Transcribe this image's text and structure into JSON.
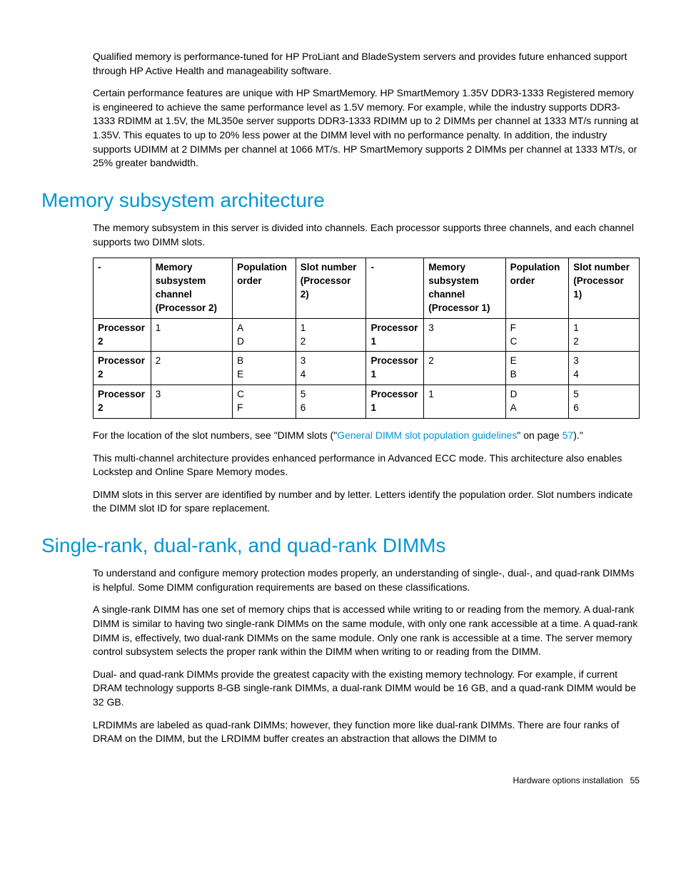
{
  "intro": {
    "p1": "Qualified memory is performance-tuned for HP ProLiant and BladeSystem servers and provides future enhanced support through HP Active Health and manageability software.",
    "p2": "Certain performance features are unique with HP SmartMemory. HP SmartMemory 1.35V DDR3-1333 Registered memory is engineered to achieve the same performance level as 1.5V memory. For example, while the industry supports DDR3-1333 RDIMM at 1.5V, the ML350e server supports DDR3-1333 RDIMM up to 2 DIMMs per channel at 1333 MT/s running at 1.35V. This equates to up to 20% less power at the DIMM level with no performance penalty. In addition, the industry supports UDIMM at 2 DIMMs per channel at 1066 MT/s. HP SmartMemory supports 2 DIMMs per channel at 1333 MT/s, or 25% greater bandwidth."
  },
  "section1": {
    "title": "Memory subsystem architecture",
    "p1": "The memory subsystem in this server is divided into channels. Each processor supports three channels, and each channel supports two DIMM slots.",
    "table": {
      "headers": [
        "-",
        "Memory subsystem channel (Processor 2)",
        "Population order",
        "Slot number (Processor 2)",
        "-",
        "Memory subsystem channel (Processor 1)",
        "Population order",
        "Slot number (Processor 1)"
      ],
      "rows": [
        [
          "Processor 2",
          "1",
          "A\nD",
          "1\n2",
          "Processor 1",
          "3",
          "F\nC",
          "1\n2"
        ],
        [
          "Processor 2",
          "2",
          "B\nE",
          "3\n4",
          "Processor 1",
          "2",
          "E\nB",
          "3\n4"
        ],
        [
          "Processor 2",
          "3",
          "C\nF",
          "5\n6",
          "Processor 1",
          "1",
          "D\nA",
          "5\n6"
        ]
      ]
    },
    "p2a": "For the location of the slot numbers, see \"DIMM slots (\"",
    "p2link": "General DIMM slot population guidelines",
    "p2b": "\" on page ",
    "p2pg": "57",
    "p2c": ").\"",
    "p3": "This multi-channel architecture provides enhanced performance in Advanced ECC mode. This architecture also enables Lockstep and Online Spare Memory modes.",
    "p4": "DIMM slots in this server are identified by number and by letter. Letters identify the population order. Slot numbers indicate the DIMM slot ID for spare replacement."
  },
  "section2": {
    "title": "Single-rank, dual-rank, and quad-rank DIMMs",
    "p1": "To understand and configure memory protection modes properly, an understanding of single-, dual-, and quad-rank DIMMs is helpful. Some DIMM configuration requirements are based on these classifications.",
    "p2": "A single-rank DIMM has one set of memory chips that is accessed while writing to or reading from the memory. A dual-rank DIMM is similar to having two single-rank DIMMs on the same module, with only one rank accessible at a time. A quad-rank DIMM is, effectively, two dual-rank DIMMs on the same module. Only one rank is accessible at a time. The server memory control subsystem selects the proper rank within the DIMM when writing to or reading from the DIMM.",
    "p3": "Dual- and quad-rank DIMMs provide the greatest capacity with the existing memory technology. For example, if current DRAM technology supports 8-GB single-rank DIMMs, a dual-rank DIMM would be 16 GB, and a quad-rank DIMM would be 32 GB.",
    "p4": "LRDIMMs are labeled as quad-rank DIMMs; however, they function more like dual-rank DIMMs. There are four ranks of DRAM on the DIMM, but the LRDIMM buffer creates an abstraction that allows the DIMM to"
  },
  "footer": {
    "section": "Hardware options installation",
    "page": "55"
  }
}
